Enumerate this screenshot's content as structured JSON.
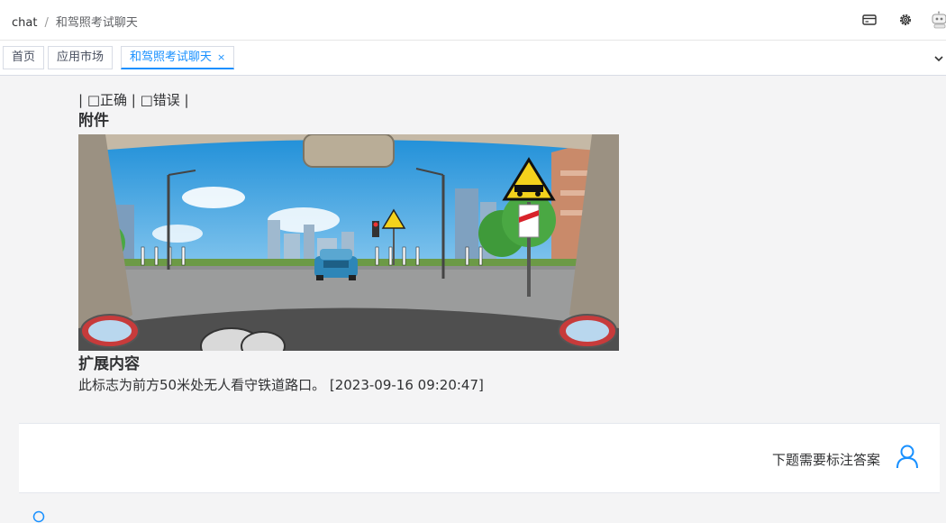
{
  "header": {
    "breadcrumb": [
      "chat",
      "和驾照考试聊天"
    ],
    "icons": [
      "card-icon",
      "settings-gear-icon",
      "robot-avatar-icon"
    ]
  },
  "tabs": [
    {
      "label": "首页",
      "active": false
    },
    {
      "label": "应用市场",
      "active": false
    },
    {
      "label": "和驾照考试聊天",
      "active": true,
      "closable": true
    }
  ],
  "tabs_close_symbol": "×",
  "message": {
    "options_text": "| □正确 | □错误 |",
    "attachment_title": "附件",
    "extension_title": "扩展内容",
    "extension_text": "此标志为前方50米处无人看守铁道路口。 [2023-09-16 09:20:47]"
  },
  "reply": {
    "text": "下题需要标注答案"
  },
  "colors": {
    "accent": "#1890ff",
    "panel_bg": "#f4f4f5",
    "text": "#303133"
  }
}
